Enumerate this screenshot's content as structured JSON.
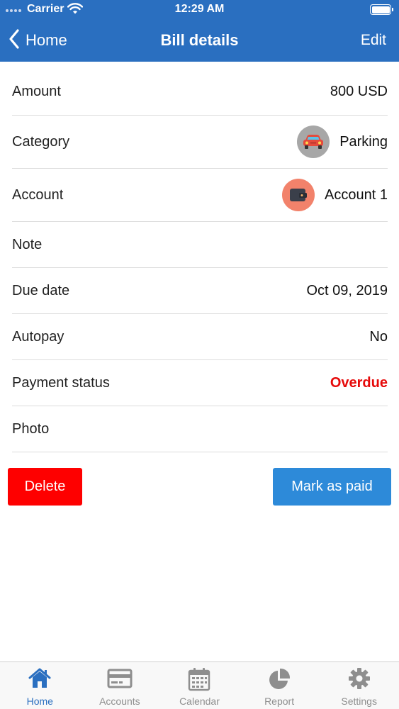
{
  "status_bar": {
    "carrier": "Carrier",
    "time": "12:29 AM"
  },
  "nav": {
    "back_label": "Home",
    "title": "Bill details",
    "edit_label": "Edit"
  },
  "details": {
    "amount": {
      "label": "Amount",
      "value": "800 USD"
    },
    "category": {
      "label": "Category",
      "value": "Parking",
      "icon": "car-icon"
    },
    "account": {
      "label": "Account",
      "value": "Account 1",
      "icon": "wallet-icon"
    },
    "note": {
      "label": "Note",
      "value": ""
    },
    "due_date": {
      "label": "Due date",
      "value": "Oct 09, 2019"
    },
    "autopay": {
      "label": "Autopay",
      "value": "No"
    },
    "payment_status": {
      "label": "Payment status",
      "value": "Overdue"
    },
    "photo": {
      "label": "Photo",
      "value": ""
    }
  },
  "actions": {
    "delete_label": "Delete",
    "mark_paid_label": "Mark as paid"
  },
  "tabs": [
    {
      "label": "Home",
      "icon": "home-icon",
      "active": true
    },
    {
      "label": "Accounts",
      "icon": "card-icon",
      "active": false
    },
    {
      "label": "Calendar",
      "icon": "calendar-icon",
      "active": false
    },
    {
      "label": "Report",
      "icon": "pie-chart-icon",
      "active": false
    },
    {
      "label": "Settings",
      "icon": "gear-icon",
      "active": false
    }
  ],
  "colors": {
    "nav": "#2a6fc0",
    "delete": "#fe0000",
    "mark_paid": "#2d8ad9",
    "overdue": "#e60a0a",
    "tab_active": "#2a6fc0",
    "tab_inactive": "#8e8e8e"
  }
}
